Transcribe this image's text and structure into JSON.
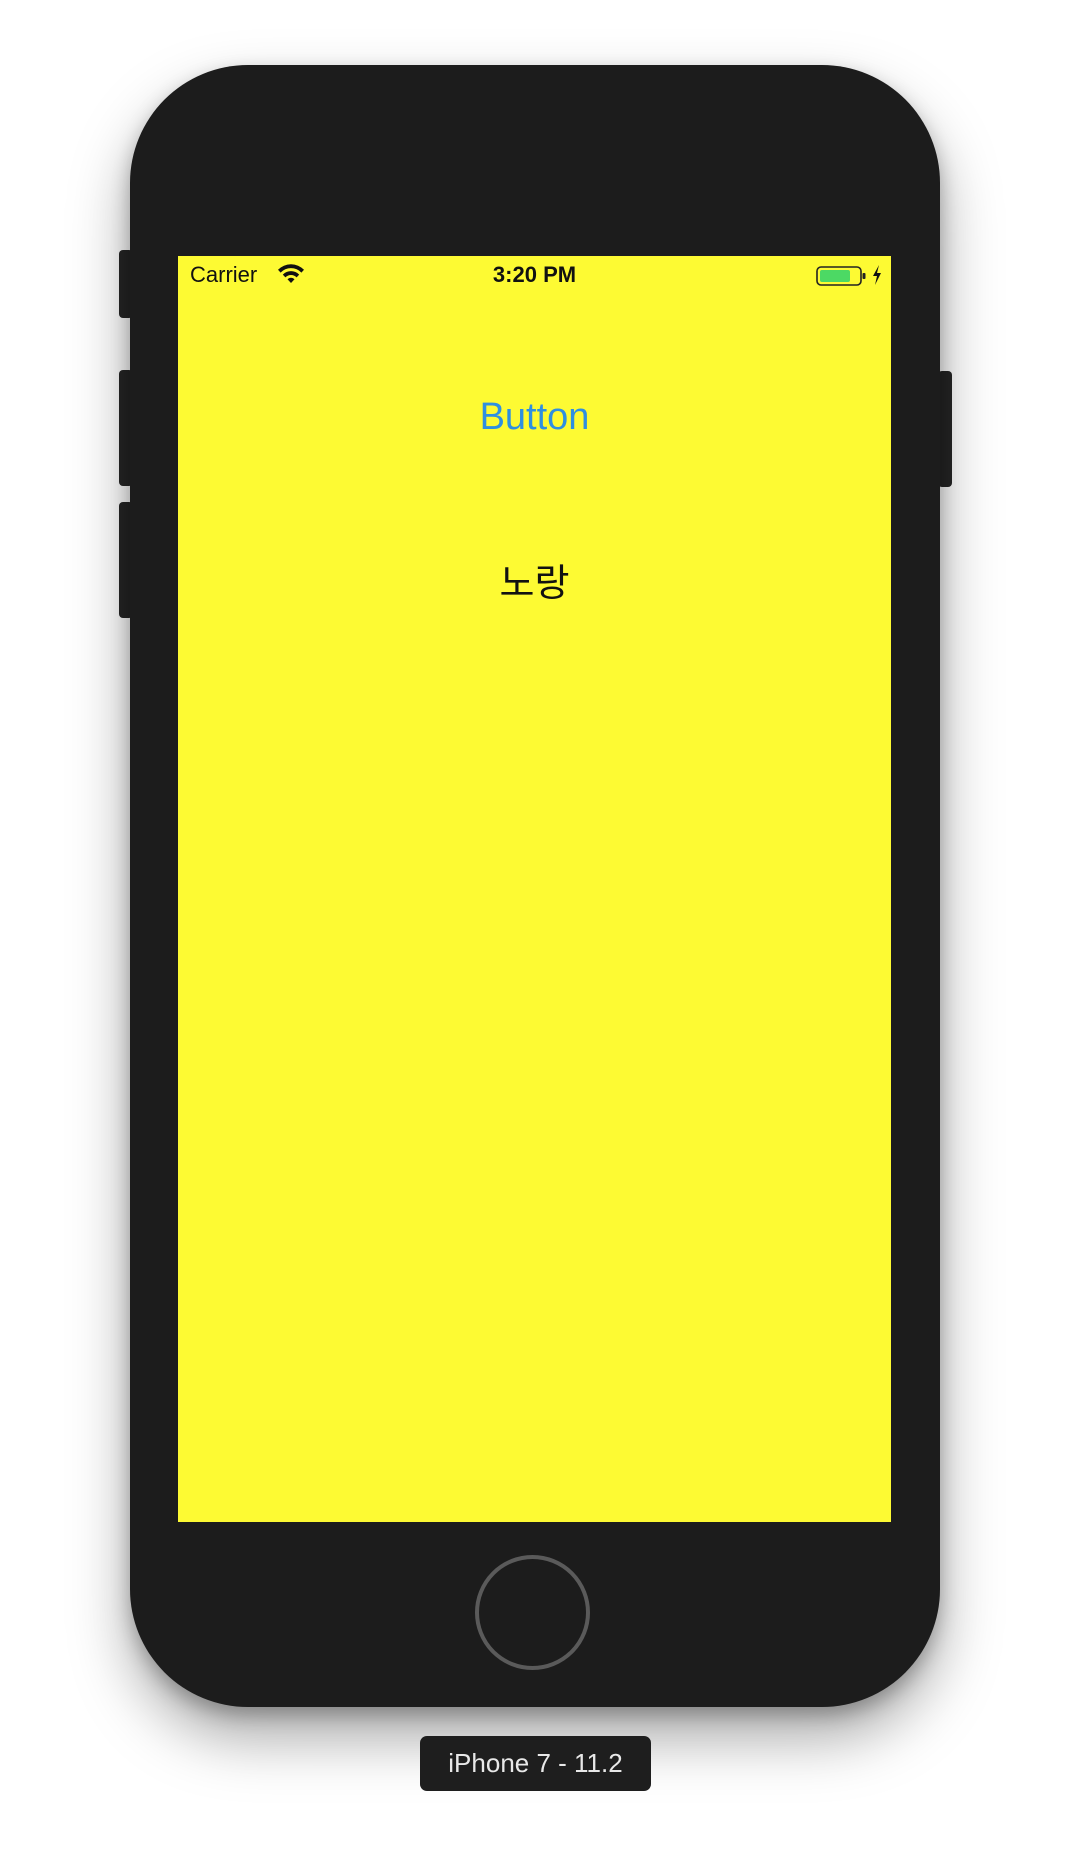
{
  "status_bar": {
    "carrier": "Carrier",
    "time": "3:20 PM",
    "wifi_icon": "wifi-icon",
    "battery_icon": "battery-icon",
    "charging_icon": "charging-bolt-icon"
  },
  "screen": {
    "background": "#fdfa33",
    "button_label": "Button",
    "button_color": "#2f8fe0",
    "label_text": "노랑"
  },
  "device": {
    "name_label": "iPhone 7 - 11.2",
    "home_button_icon": "home-button-icon"
  }
}
